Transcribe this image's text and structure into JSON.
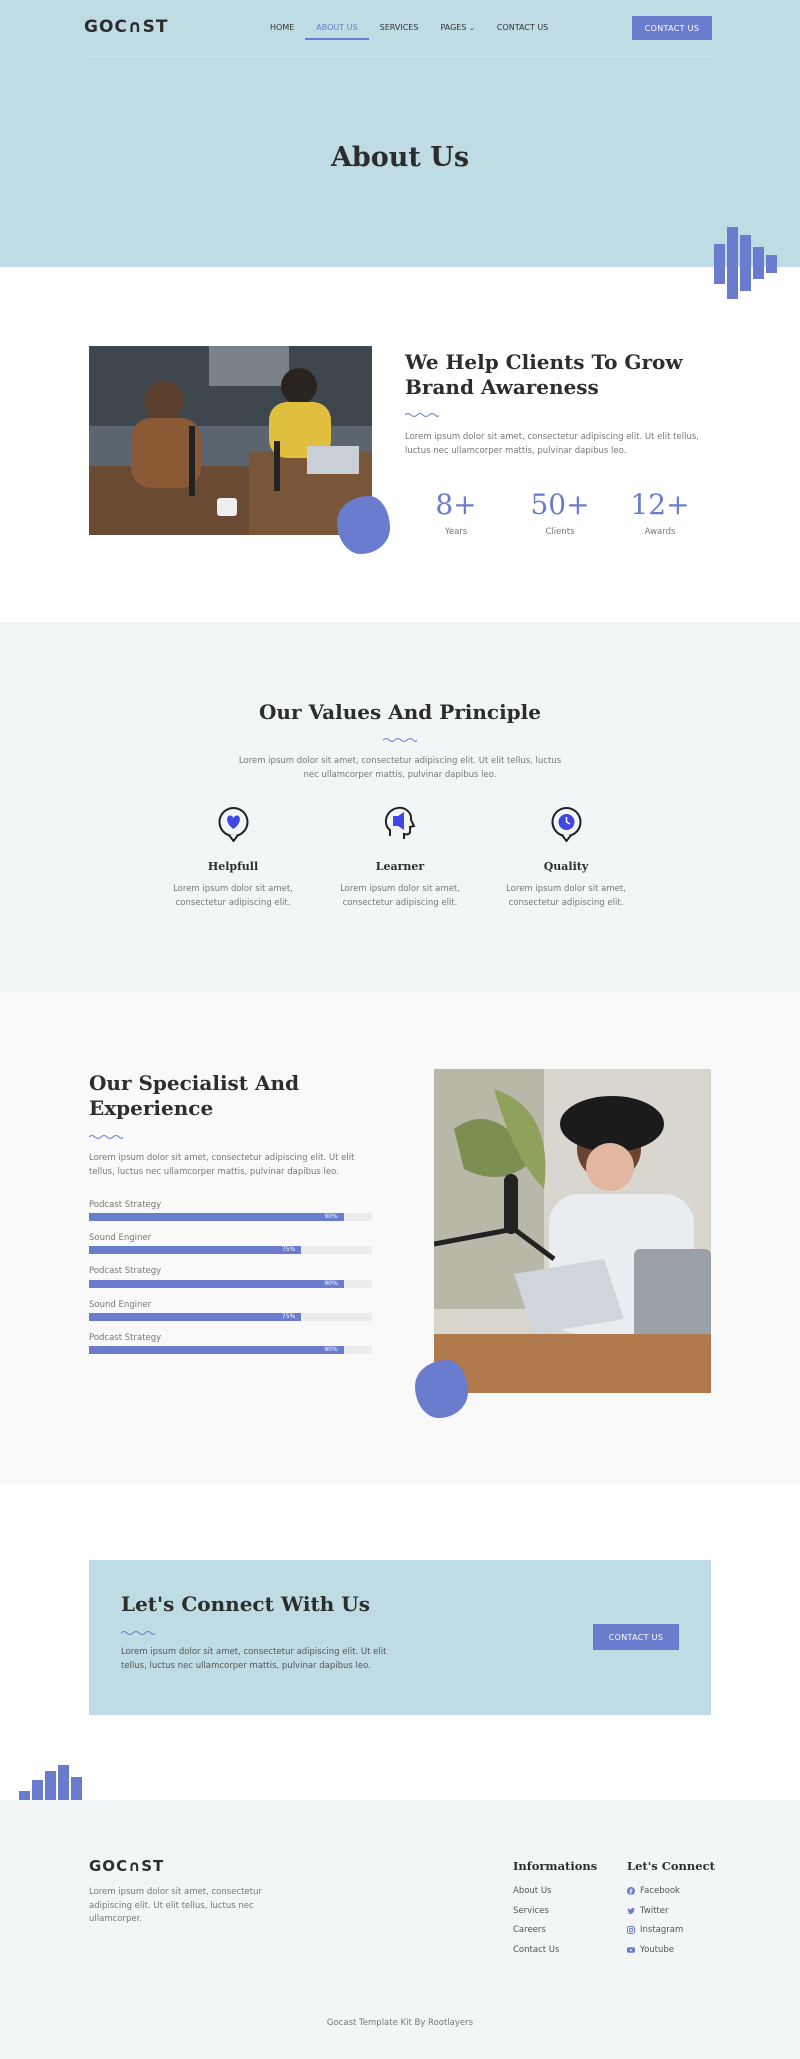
{
  "brand": {
    "logo": "GOC∩ST",
    "accent_color": "#6a7ccd",
    "hero_bg": "#bfdbe3"
  },
  "nav": {
    "items": [
      {
        "label": "HOME"
      },
      {
        "label": "ABOUT US"
      },
      {
        "label": "SERVICES"
      },
      {
        "label": "PAGES"
      },
      {
        "label": "CONTACT US"
      }
    ],
    "pages_chevron": "chevron-down-icon",
    "cta": "CONTACT US"
  },
  "hero": {
    "title": "About Us"
  },
  "about": {
    "title_line1": "We Help Clients To Grow",
    "title_line2": "Brand Awareness",
    "text": "Lorem ipsum dolor sit amet, consectetur adipiscing elit. Ut elit tellus, luctus nec ullamcorper mattis, pulvinar dapibus leo.",
    "stats": [
      {
        "value": "8+",
        "label": "Years"
      },
      {
        "value": "50+",
        "label": "Clients"
      },
      {
        "value": "12+",
        "label": "Awards"
      }
    ]
  },
  "values": {
    "title": "Our Values And Principle",
    "text_line1": "Lorem ipsum dolor sit amet, consectetur adipiscing elit. Ut elit tellus, luctus",
    "text_line2": "nec ullamcorper mattis, pulvinar dapibus leo.",
    "items": [
      {
        "title": "Helpfull",
        "icon": "heart-chat-icon",
        "text_line1": "Lorem ipsum dolor sit amet,",
        "text_line2": "consectetur adipiscing elit."
      },
      {
        "title": "Learner",
        "icon": "head-speaker-icon",
        "text_line1": "Lorem ipsum dolor sit amet,",
        "text_line2": "consectetur adipiscing elit."
      },
      {
        "title": "Quality",
        "icon": "clock-chat-icon",
        "text_line1": "Lorem ipsum dolor sit amet,",
        "text_line2": "consectetur adipiscing elit."
      }
    ]
  },
  "specialist": {
    "title_line1": "Our Specialist And",
    "title_line2": "Experience",
    "text_line1": "Lorem ipsum dolor sit amet, consectetur adipiscing elit. Ut elit",
    "text_line2": "tellus, luctus nec ullamcorper mattis, pulvinar dapibus leo.",
    "skills": [
      {
        "label": "Podcast Strategy",
        "percent": 90,
        "pct_text": "90%"
      },
      {
        "label": "Sound Enginer",
        "percent": 75,
        "pct_text": "75%"
      },
      {
        "label": "Podcast Strategy",
        "percent": 90,
        "pct_text": "90%"
      },
      {
        "label": "Sound Enginer",
        "percent": 75,
        "pct_text": "75%"
      },
      {
        "label": "Podcast Strategy",
        "percent": 90,
        "pct_text": "90%"
      }
    ]
  },
  "connect": {
    "title": "Let's Connect With Us",
    "text_line1": "Lorem ipsum dolor sit amet, consectetur adipiscing elit. Ut elit",
    "text_line2": "tellus, luctus nec ullamcorper mattis, pulvinar dapibus leo.",
    "cta": "CONTACT US"
  },
  "footer": {
    "logo": "GOC∩ST",
    "text_line1": "Lorem ipsum dolor sit amet, consectetur",
    "text_line2": "adipiscing elit. Ut elit tellus, luctus nec",
    "text_line3": "ullamcorper.",
    "info_title": "Informations",
    "info_links": [
      "About Us",
      "Services",
      "Careers",
      "Contact Us"
    ],
    "connect_title": "Let's Connect",
    "social": [
      {
        "label": "Facebook",
        "icon": "facebook-icon"
      },
      {
        "label": "Twitter",
        "icon": "twitter-icon"
      },
      {
        "label": "Instagram",
        "icon": "instagram-icon"
      },
      {
        "label": "Youtube",
        "icon": "youtube-icon"
      }
    ],
    "copyright": "Gocast Template Kit By Rootlayers"
  }
}
